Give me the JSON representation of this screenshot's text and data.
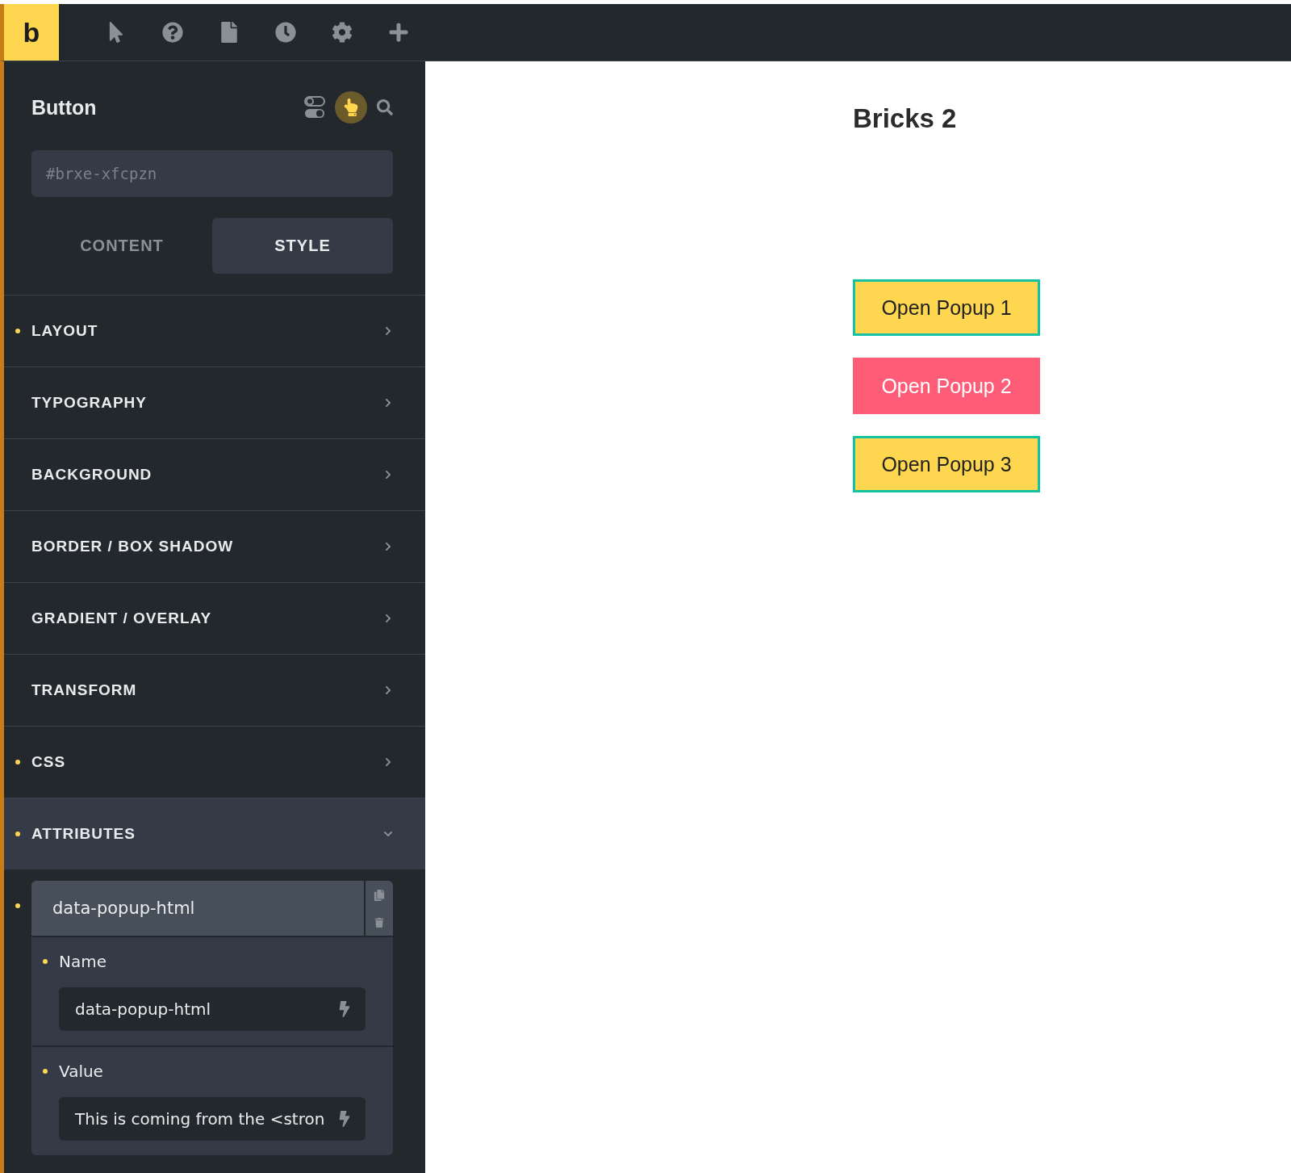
{
  "toolbar": {
    "logo": "b",
    "tools": [
      {
        "kind": "pointer"
      },
      {
        "kind": "help"
      },
      {
        "kind": "page"
      },
      {
        "kind": "history"
      },
      {
        "kind": "settings"
      },
      {
        "kind": "add"
      }
    ]
  },
  "panel": {
    "title": "Button",
    "id_placeholder": "#brxe-xfcpzn",
    "tabs": [
      {
        "label": "CONTENT",
        "selected": false
      },
      {
        "label": "STYLE",
        "selected": true
      }
    ],
    "sections": [
      {
        "label": "LAYOUT",
        "modified": true,
        "expanded": false
      },
      {
        "label": "TYPOGRAPHY",
        "modified": false,
        "expanded": false
      },
      {
        "label": "BACKGROUND",
        "modified": false,
        "expanded": false
      },
      {
        "label": "BORDER / BOX SHADOW",
        "modified": false,
        "expanded": false
      },
      {
        "label": "GRADIENT / OVERLAY",
        "modified": false,
        "expanded": false
      },
      {
        "label": "TRANSFORM",
        "modified": false,
        "expanded": false
      },
      {
        "label": "CSS",
        "modified": true,
        "expanded": false
      },
      {
        "label": "ATTRIBUTES",
        "modified": true,
        "expanded": true
      }
    ],
    "attribute": {
      "title": "data-popup-html",
      "fields": [
        {
          "label": "Name",
          "value": "data-popup-html"
        },
        {
          "label": "Value",
          "value": "This is coming from the <stron"
        }
      ]
    }
  },
  "canvas": {
    "heading": "Bricks 2",
    "buttons": [
      {
        "label": "Open Popup 1",
        "kind": "outlined"
      },
      {
        "label": "Open Popup 2",
        "kind": "danger"
      },
      {
        "label": "Open Popup 3",
        "kind": "outlined"
      }
    ]
  }
}
